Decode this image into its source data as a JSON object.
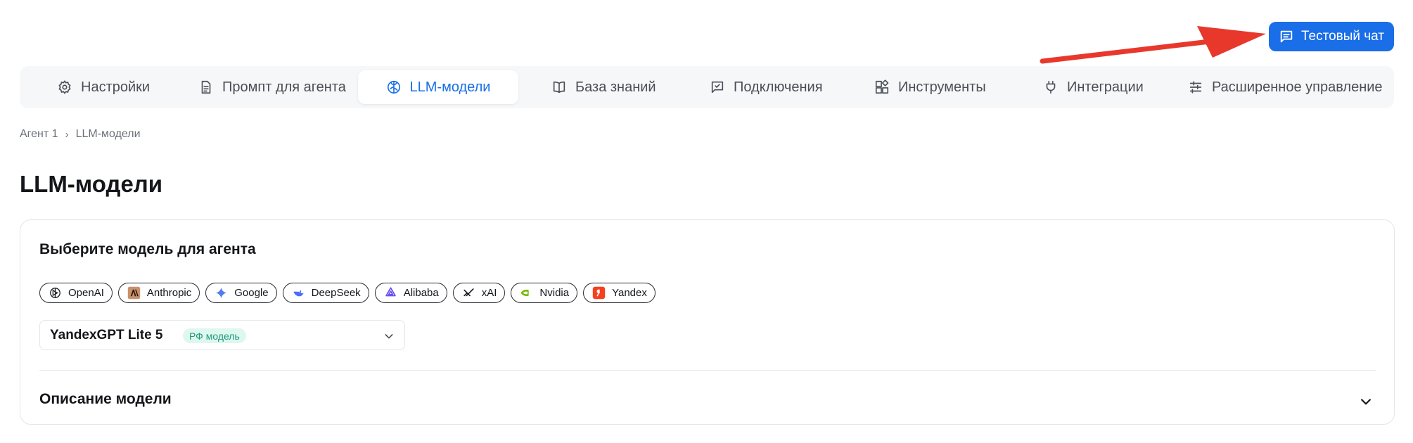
{
  "header": {
    "test_chat_label": "Тестовый чат",
    "accent_color": "#1a6ee8",
    "arrow_color": "#e8382c"
  },
  "tabs": [
    {
      "label": "Настройки",
      "icon": "gear-icon"
    },
    {
      "label": "Промпт для агента",
      "icon": "document-icon"
    },
    {
      "label": "LLM-модели",
      "icon": "brain-icon",
      "active": true
    },
    {
      "label": "База знаний",
      "icon": "book-icon"
    },
    {
      "label": "Подключения",
      "icon": "chat-check-icon"
    },
    {
      "label": "Инструменты",
      "icon": "blocks-icon"
    },
    {
      "label": "Интеграции",
      "icon": "plug-icon"
    },
    {
      "label": "Расширенное управление",
      "icon": "sliders-icon"
    }
  ],
  "breadcrumb": {
    "items": [
      "Агент 1",
      "LLM-модели"
    ],
    "separator": "›"
  },
  "page": {
    "title": "LLM-модели"
  },
  "model_card": {
    "heading": "Выберите модель для агента",
    "providers": [
      {
        "label": "OpenAI",
        "icon": "openai-icon"
      },
      {
        "label": "Anthropic",
        "icon": "anthropic-icon"
      },
      {
        "label": "Google",
        "icon": "google-icon"
      },
      {
        "label": "DeepSeek",
        "icon": "deepseek-icon"
      },
      {
        "label": "Alibaba",
        "icon": "alibaba-icon"
      },
      {
        "label": "xAI",
        "icon": "xai-icon"
      },
      {
        "label": "Nvidia",
        "icon": "nvidia-icon"
      },
      {
        "label": "Yandex",
        "icon": "yandex-icon"
      }
    ],
    "selected_model": "YandexGPT Lite 5",
    "selected_model_badge": "РФ модель",
    "description_title": "Описание модели"
  }
}
